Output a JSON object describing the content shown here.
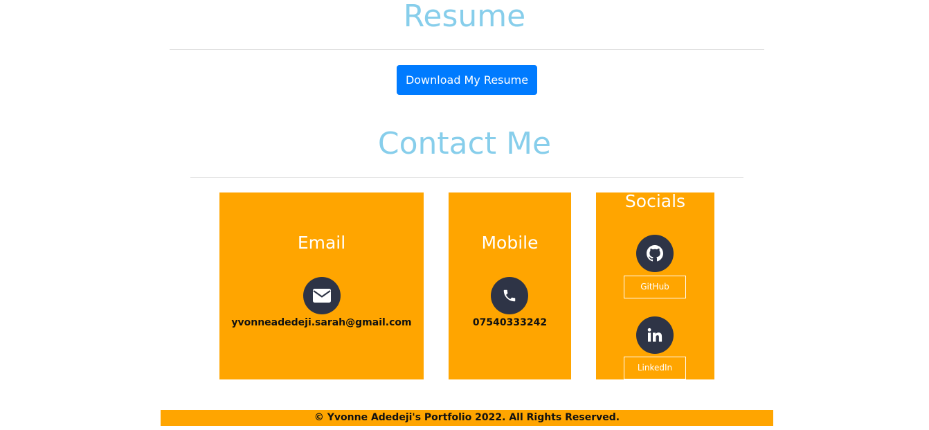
{
  "resume": {
    "title": "Resume",
    "download_label": "Download My Resume"
  },
  "contact": {
    "title": "Contact Me",
    "email": {
      "title": "Email",
      "icon": "envelope-icon",
      "value": "yvonneadedeji.sarah@gmail.com"
    },
    "mobile": {
      "title": "Mobile",
      "icon": "phone-icon",
      "value": "07540333242"
    },
    "socials": {
      "title": "Socials",
      "github": {
        "icon": "github-icon",
        "label": "GitHub"
      },
      "linkedin": {
        "icon": "linkedin-icon",
        "label": "LinkedIn"
      }
    }
  },
  "footer": {
    "text": "© Yvonne Adedeji's Portfolio 2022. All Rights Reserved."
  },
  "colors": {
    "heading": "#87ceeb",
    "button": "#007bff",
    "card": "#ffa500",
    "icon_circle": "#2e3446"
  }
}
